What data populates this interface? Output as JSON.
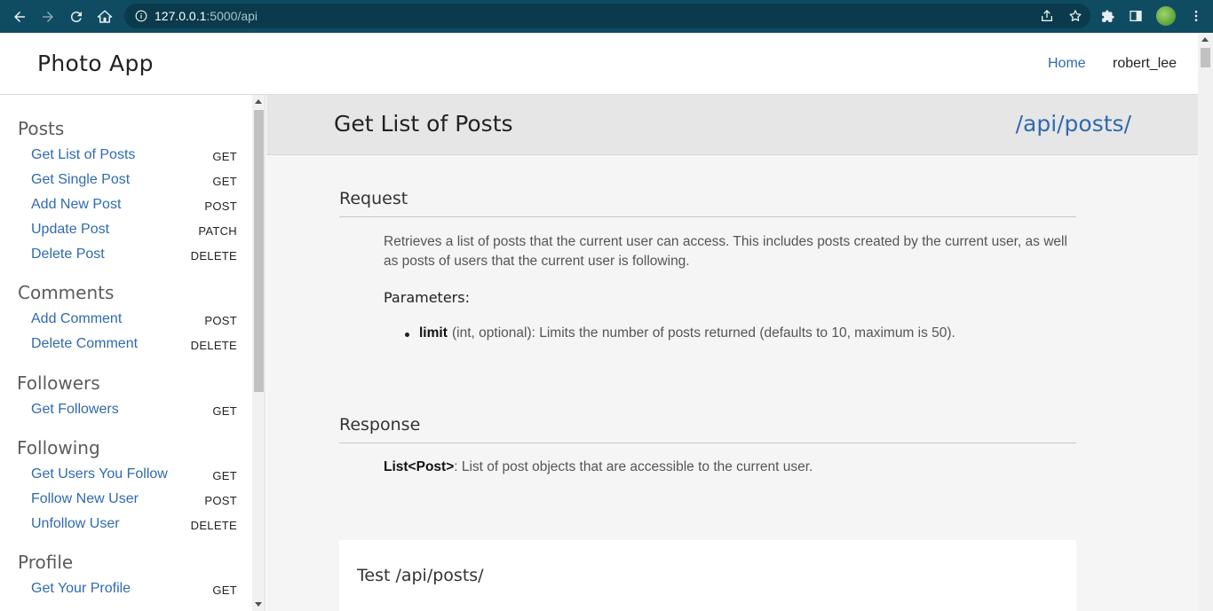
{
  "browser": {
    "url_host": "127.0.0.1",
    "url_path": ":5000/api"
  },
  "app": {
    "brand": "Photo App",
    "nav_home": "Home",
    "nav_user": "robert_lee"
  },
  "sidebar": {
    "groups": [
      {
        "title": "Posts",
        "items": [
          {
            "label": "Get List of Posts",
            "method": "GET"
          },
          {
            "label": "Get Single Post",
            "method": "GET"
          },
          {
            "label": "Add New Post",
            "method": "POST"
          },
          {
            "label": "Update Post",
            "method": "PATCH"
          },
          {
            "label": "Delete Post",
            "method": "DELETE"
          }
        ]
      },
      {
        "title": "Comments",
        "items": [
          {
            "label": "Add Comment",
            "method": "POST"
          },
          {
            "label": "Delete Comment",
            "method": "DELETE"
          }
        ]
      },
      {
        "title": "Followers",
        "items": [
          {
            "label": "Get Followers",
            "method": "GET"
          }
        ]
      },
      {
        "title": "Following",
        "items": [
          {
            "label": "Get Users You Follow",
            "method": "GET"
          },
          {
            "label": "Follow New User",
            "method": "POST"
          },
          {
            "label": "Unfollow User",
            "method": "DELETE"
          }
        ]
      },
      {
        "title": "Profile",
        "items": [
          {
            "label": "Get Your Profile",
            "method": "GET"
          }
        ]
      }
    ]
  },
  "main": {
    "title": "Get List of Posts",
    "endpoint": "/api/posts/",
    "request": {
      "heading": "Request",
      "description": "Retrieves a list of posts that the current user can access. This includes posts created by the current user, as well as posts of users that the current user is following.",
      "params_heading": "Parameters:",
      "param_name": "limit",
      "param_desc": "(int, optional): Limits the number of posts returned (defaults to 10, maximum is 50)."
    },
    "response": {
      "heading": "Response",
      "type": "List<Post>",
      "desc": ": List of post objects that are accessible to the current user."
    },
    "test": {
      "title": "Test /api/posts/"
    }
  }
}
